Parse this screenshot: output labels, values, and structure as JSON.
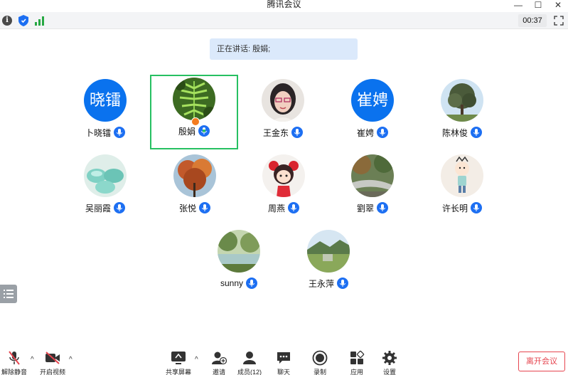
{
  "window": {
    "title": "腾讯会议",
    "controls": [
      "—",
      "☐",
      "✕"
    ]
  },
  "toolbar": {
    "timer": "00:37"
  },
  "speaking": {
    "text": "正在讲话: 殷娟;"
  },
  "participants": [
    {
      "name": "卜晓镭",
      "avatar_text": "晓镭",
      "avatar_color": "#0a72ee"
    },
    {
      "name": "殷娟",
      "active": true,
      "avatar_photo": "fern"
    },
    {
      "name": "王金东",
      "avatar_photo": "woman-glasses"
    },
    {
      "name": "崔娉",
      "avatar_text": "崔娉",
      "avatar_color": "#0a72ee"
    },
    {
      "name": "陈林俊",
      "avatar_photo": "tree"
    },
    {
      "name": "吴丽霞",
      "avatar_photo": "teal-bowls"
    },
    {
      "name": "张悦",
      "avatar_photo": "autumn-tree"
    },
    {
      "name": "周燕",
      "avatar_photo": "cartoon-girl"
    },
    {
      "name": "劉翠",
      "avatar_photo": "river"
    },
    {
      "name": "许长明",
      "avatar_photo": "cartoon-kid"
    },
    {
      "name": "sunny",
      "avatar_photo": "park-lake"
    },
    {
      "name": "王永萍",
      "avatar_photo": "mountain-field"
    }
  ],
  "bottom": {
    "unmute": "解除静音",
    "start_video": "开启视频",
    "share_screen": "共享屏幕",
    "invite": "邀请",
    "members": "成员(12)",
    "chat": "聊天",
    "record": "录制",
    "apps": "应用",
    "settings": "设置",
    "leave": "离开会议"
  },
  "colors": {
    "accent": "#1d6ff2",
    "active_border": "#27c062",
    "leave": "#e6454f"
  }
}
